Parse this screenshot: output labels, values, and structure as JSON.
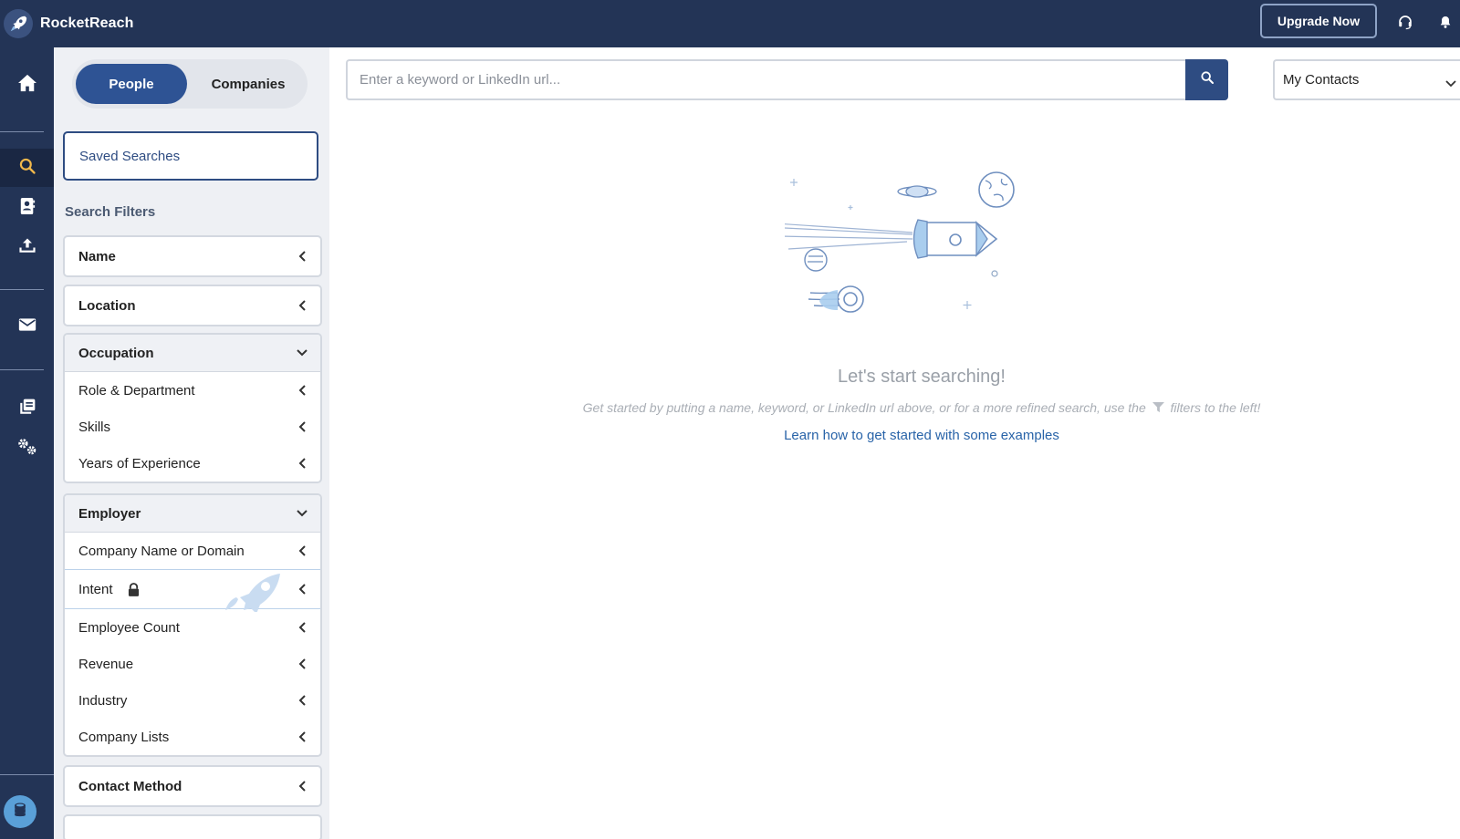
{
  "app": {
    "name": "RocketReach"
  },
  "topbar": {
    "upgrade_label": "Upgrade Now"
  },
  "toggle": {
    "people": "People",
    "companies": "Companies"
  },
  "saved_searches": "Saved Searches",
  "filters_title": "Search Filters",
  "filters": {
    "name": "Name",
    "location": "Location",
    "occupation": {
      "label": "Occupation",
      "items": [
        "Role & Department",
        "Skills",
        "Years of Experience"
      ]
    },
    "employer": {
      "label": "Employer",
      "items": [
        "Company Name or Domain",
        "Intent",
        "Employee Count",
        "Revenue",
        "Industry",
        "Company Lists"
      ]
    },
    "contact_method": "Contact Method"
  },
  "search": {
    "placeholder": "Enter a keyword or LinkedIn url..."
  },
  "contacts_select": {
    "value": "My Contacts"
  },
  "empty_state": {
    "title": "Let's start searching!",
    "subtitle_before": "Get started by putting a name, keyword, or LinkedIn url above, or for a more refined search, use the",
    "subtitle_after": "filters to the left!",
    "link": "Learn how to get started with some examples"
  },
  "colors": {
    "navy": "#233456",
    "accent": "#2e4c82",
    "link": "#2863a8"
  }
}
